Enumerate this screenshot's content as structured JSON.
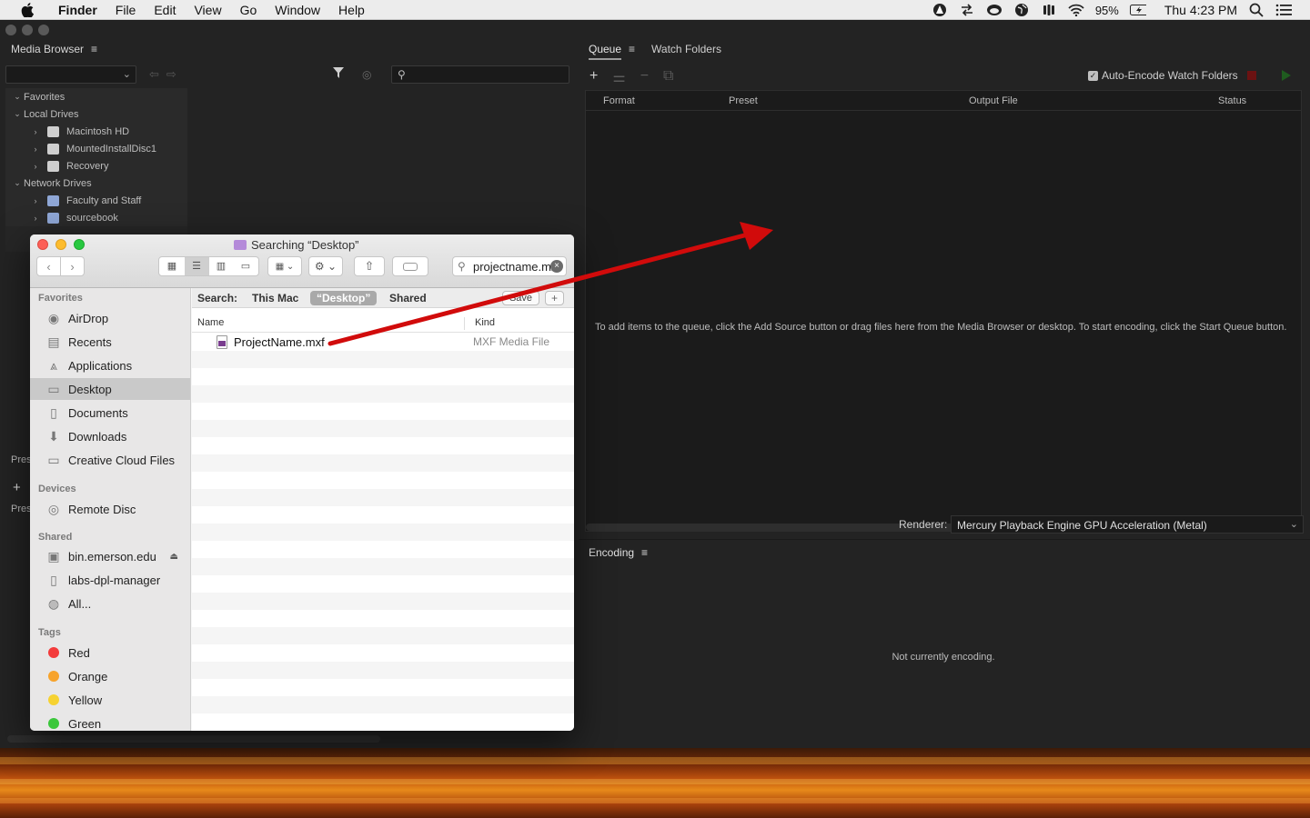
{
  "menubar": {
    "app": "Finder",
    "items": [
      "File",
      "Edit",
      "View",
      "Go",
      "Window",
      "Help"
    ],
    "battery": "95%",
    "clock": "Thu 4:23 PM"
  },
  "media_browser": {
    "title": "Media Browser",
    "tree": [
      {
        "label": "Favorites",
        "level": 0
      },
      {
        "label": "Local Drives",
        "level": 0
      },
      {
        "label": "Macintosh HD",
        "level": 1
      },
      {
        "label": "MountedInstallDisc1",
        "level": 1
      },
      {
        "label": "Recovery",
        "level": 1
      },
      {
        "label": "Network Drives",
        "level": 0
      },
      {
        "label": "Faculty and Staff",
        "level": 1
      },
      {
        "label": "sourcebook",
        "level": 1
      }
    ]
  },
  "left_stubs": {
    "pres": "Pres",
    "pres2": "Pres",
    "plus": "+"
  },
  "queue": {
    "tab_queue": "Queue",
    "tab_watch": "Watch Folders",
    "auto_encode": "Auto-Encode Watch Folders",
    "columns": {
      "format": "Format",
      "preset": "Preset",
      "output": "Output File",
      "status": "Status"
    },
    "hint": "To add items to the queue, click the Add Source button or drag files here from the Media Browser or desktop.  To start encoding, click the Start Queue button.",
    "renderer_label": "Renderer:",
    "renderer_value": "Mercury Playback Engine GPU Acceleration (Metal)"
  },
  "encoding": {
    "title": "Encoding",
    "message": "Not currently encoding."
  },
  "finder": {
    "title": "Searching “Desktop”",
    "search_value": "projectname.mxf",
    "scope": {
      "label": "Search:",
      "this_mac": "This Mac",
      "desktop": "“Desktop”",
      "shared": "Shared",
      "save": "Save",
      "plus": "+"
    },
    "columns": {
      "name": "Name",
      "kind": "Kind"
    },
    "file": {
      "name": "ProjectName.mxf",
      "kind": "MXF Media File"
    },
    "sidebar": {
      "favorites_label": "Favorites",
      "favorites": [
        "AirDrop",
        "Recents",
        "Applications",
        "Desktop",
        "Documents",
        "Downloads",
        "Creative Cloud Files"
      ],
      "devices_label": "Devices",
      "devices": [
        "Remote Disc"
      ],
      "shared_label": "Shared",
      "shared": [
        "bin.emerson.edu",
        "labs-dpl-manager",
        "All..."
      ],
      "tags_label": "Tags",
      "tags": [
        {
          "label": "Red",
          "color": "#f33b3b"
        },
        {
          "label": "Orange",
          "color": "#f7a32b"
        },
        {
          "label": "Yellow",
          "color": "#f6d231"
        },
        {
          "label": "Green",
          "color": "#3bc73b"
        }
      ]
    }
  },
  "colors": {
    "arrow": "#d10b0b"
  }
}
